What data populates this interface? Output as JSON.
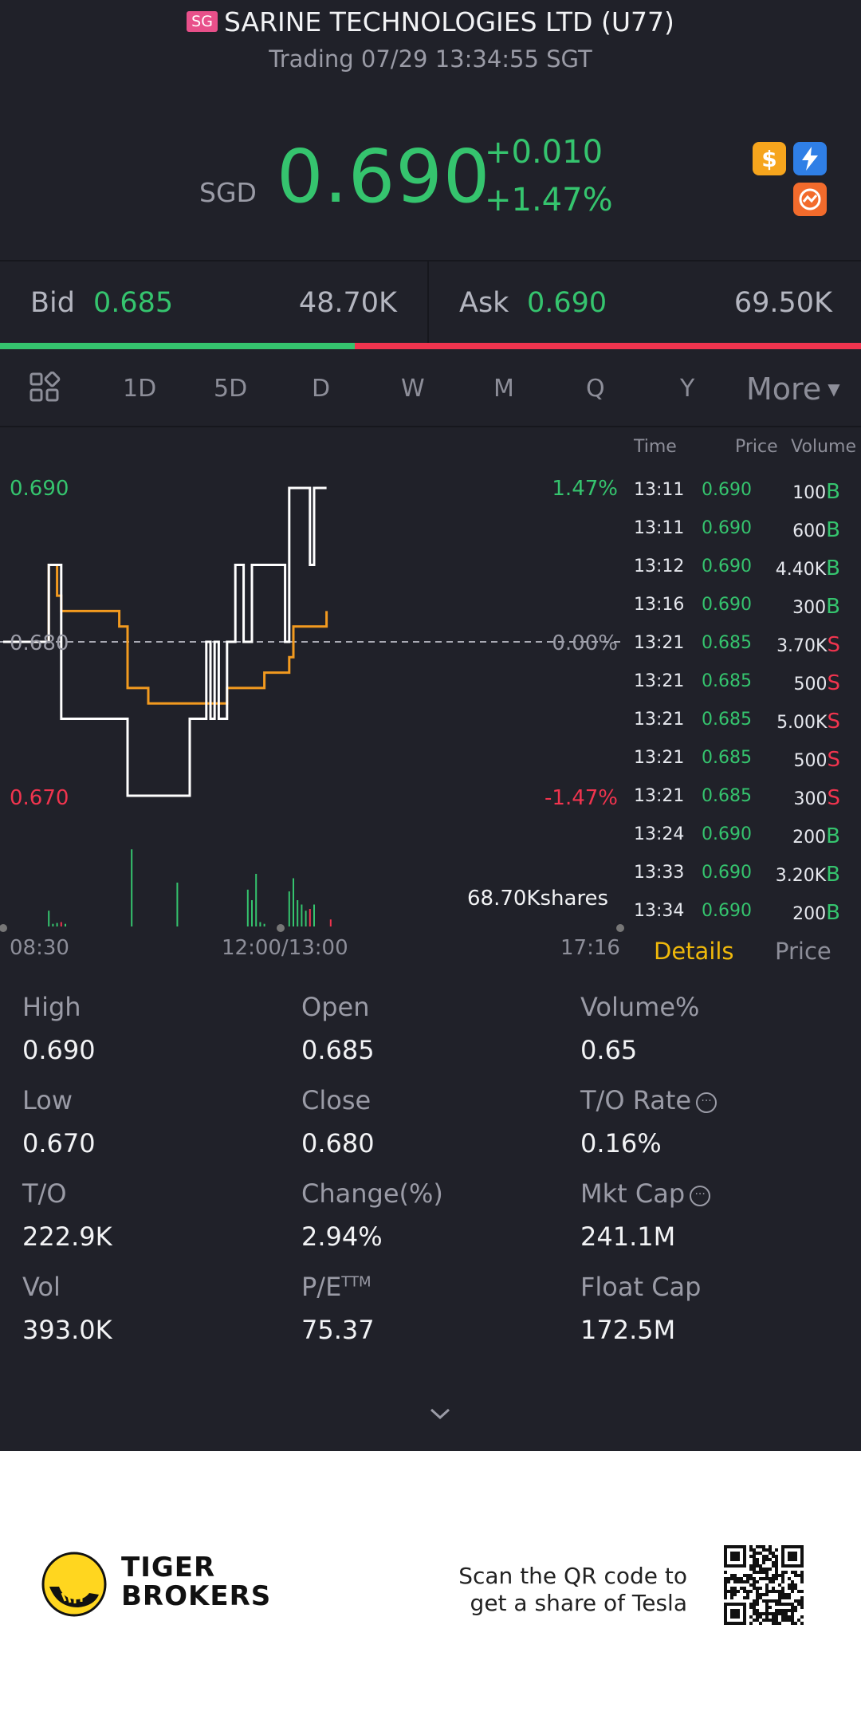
{
  "header": {
    "market_badge": "SG",
    "title": "SARINE TECHNOLOGIES LTD (U77)",
    "status": "Trading 07/29 13:34:55 SGT"
  },
  "quote": {
    "currency": "SGD",
    "price": "0.690",
    "change": "+0.010",
    "change_pct": "+1.47%",
    "up_color": "#35c46e",
    "down_color": "#f0344e"
  },
  "bid_ask": {
    "bid_label": "Bid",
    "bid_price": "0.685",
    "bid_qty": "48.70K",
    "ask_label": "Ask",
    "ask_price": "0.690",
    "ask_qty": "69.50K",
    "bid_ratio": 0.412
  },
  "periods": {
    "items": [
      "1D",
      "5D",
      "D",
      "W",
      "M",
      "Q",
      "Y"
    ],
    "active": "1D",
    "more_label": "More"
  },
  "chart": {
    "y_high": "0.690",
    "y_mid": "0.680",
    "y_low": "0.670",
    "pct_high": "1.47%",
    "pct_mid": "0.00%",
    "pct_low": "-1.47%",
    "volume_label": "68.70Kshares",
    "x_start": "08:30",
    "x_mid": "12:00/13:00",
    "x_end": "17:16"
  },
  "chart_data": {
    "type": "line",
    "ylim": [
      0.67,
      0.69
    ],
    "prev_close": 0.68,
    "series": [
      {
        "values": [
          0.68,
          0.68,
          0.68,
          0.68,
          0.68,
          0.68,
          0.68,
          0.68,
          0.68,
          0.68,
          0.68,
          0.685,
          0.685,
          0.685,
          0.675,
          0.675,
          0.675,
          0.675,
          0.675,
          0.675,
          0.675,
          0.675,
          0.675,
          0.675,
          0.675,
          0.675,
          0.675,
          0.675,
          0.675,
          0.675,
          0.67,
          0.67,
          0.67,
          0.67,
          0.67,
          0.67,
          0.67,
          0.67,
          0.67,
          0.67,
          0.67,
          0.67,
          0.67,
          0.67,
          0.67,
          0.675,
          0.675,
          0.675,
          0.675,
          0.68,
          0.675,
          0.68,
          0.675,
          0.675,
          0.68,
          0.68,
          0.685,
          0.685,
          0.68,
          0.68,
          0.685,
          0.685,
          0.685,
          0.685,
          0.685,
          0.685,
          0.685,
          0.685,
          0.68,
          0.69,
          0.69,
          0.69,
          0.69,
          0.69,
          0.685,
          0.69,
          0.69,
          0.69,
          0.69
        ]
      },
      {
        "values": [
          0.68,
          0.68,
          0.68,
          0.68,
          0.68,
          0.68,
          0.68,
          0.68,
          0.68,
          0.68,
          0.68,
          0.685,
          0.685,
          0.683,
          0.682,
          0.682,
          0.682,
          0.682,
          0.682,
          0.682,
          0.682,
          0.682,
          0.682,
          0.682,
          0.682,
          0.682,
          0.682,
          0.682,
          0.681,
          0.681,
          0.677,
          0.677,
          0.677,
          0.677,
          0.677,
          0.676,
          0.676,
          0.676,
          0.676,
          0.676,
          0.676,
          0.676,
          0.676,
          0.676,
          0.676,
          0.676,
          0.676,
          0.676,
          0.676,
          0.676,
          0.676,
          0.676,
          0.676,
          0.676,
          0.677,
          0.677,
          0.677,
          0.677,
          0.677,
          0.677,
          0.677,
          0.677,
          0.677,
          0.678,
          0.678,
          0.678,
          0.678,
          0.678,
          0.678,
          0.679,
          0.681,
          0.681,
          0.681,
          0.681,
          0.681,
          0.681,
          0.681,
          0.681,
          0.682
        ]
      }
    ],
    "volume": [
      0,
      0,
      0,
      0,
      0,
      0,
      0,
      0,
      0,
      0,
      0,
      18,
      3,
      4,
      5,
      3,
      0,
      0,
      0,
      0,
      0,
      0,
      0,
      0,
      0,
      0,
      0,
      0,
      0,
      0,
      0,
      88,
      0,
      0,
      0,
      0,
      0,
      0,
      0,
      0,
      0,
      0,
      50,
      0,
      0,
      0,
      0,
      0,
      0,
      0,
      0,
      0,
      0,
      0,
      0,
      0,
      0,
      0,
      0,
      42,
      30,
      60,
      5,
      3,
      0,
      0,
      0,
      0,
      0,
      40,
      55,
      30,
      25,
      18,
      20,
      25,
      0,
      0,
      0,
      8
    ]
  },
  "ticks": {
    "head_time": "Time",
    "head_price": "Price",
    "head_volume": "Volume",
    "rows": [
      {
        "time": "13:11",
        "price": "0.690",
        "vol": "100",
        "side": "B"
      },
      {
        "time": "13:11",
        "price": "0.690",
        "vol": "600",
        "side": "B"
      },
      {
        "time": "13:12",
        "price": "0.690",
        "vol": "4.40K",
        "side": "B"
      },
      {
        "time": "13:16",
        "price": "0.690",
        "vol": "300",
        "side": "B"
      },
      {
        "time": "13:21",
        "price": "0.685",
        "vol": "3.70K",
        "side": "S"
      },
      {
        "time": "13:21",
        "price": "0.685",
        "vol": "500",
        "side": "S"
      },
      {
        "time": "13:21",
        "price": "0.685",
        "vol": "5.00K",
        "side": "S"
      },
      {
        "time": "13:21",
        "price": "0.685",
        "vol": "500",
        "side": "S"
      },
      {
        "time": "13:21",
        "price": "0.685",
        "vol": "300",
        "side": "S"
      },
      {
        "time": "13:24",
        "price": "0.690",
        "vol": "200",
        "side": "B"
      },
      {
        "time": "13:33",
        "price": "0.690",
        "vol": "3.20K",
        "side": "B"
      },
      {
        "time": "13:34",
        "price": "0.690",
        "vol": "200",
        "side": "B"
      }
    ],
    "tab_details": "Details",
    "tab_price": "Price"
  },
  "stats": [
    {
      "label": "High",
      "value": "0.690"
    },
    {
      "label": "Open",
      "value": "0.685"
    },
    {
      "label": "Volume%",
      "value": "0.65"
    },
    {
      "label": "Low",
      "value": "0.670"
    },
    {
      "label": "Close",
      "value": "0.680"
    },
    {
      "label": "T/O Rate",
      "value": "0.16%"
    },
    {
      "label": "T/O",
      "value": "222.9K"
    },
    {
      "label": "Change(%)",
      "value": "2.94%"
    },
    {
      "label": "Mkt Cap",
      "value": "241.1M"
    },
    {
      "label": "Vol",
      "value": "393.0K"
    },
    {
      "label": "P/E",
      "value": "75.37"
    },
    {
      "label": "Float Cap",
      "value": "172.5M"
    }
  ],
  "stats_pe_superscript": "TTM",
  "footer": {
    "brand_line1": "TIGER",
    "brand_line2": "BROKERS",
    "promo_line1": "Scan the QR code to",
    "promo_line2": "get a share of Tesla"
  },
  "icons": [
    "dollar-icon",
    "lightning-icon",
    "chart-badge-icon",
    "grid-layout-icon",
    "chevron-down-icon",
    "info-icon",
    "tiger-logo-icon",
    "qr-code-icon"
  ]
}
